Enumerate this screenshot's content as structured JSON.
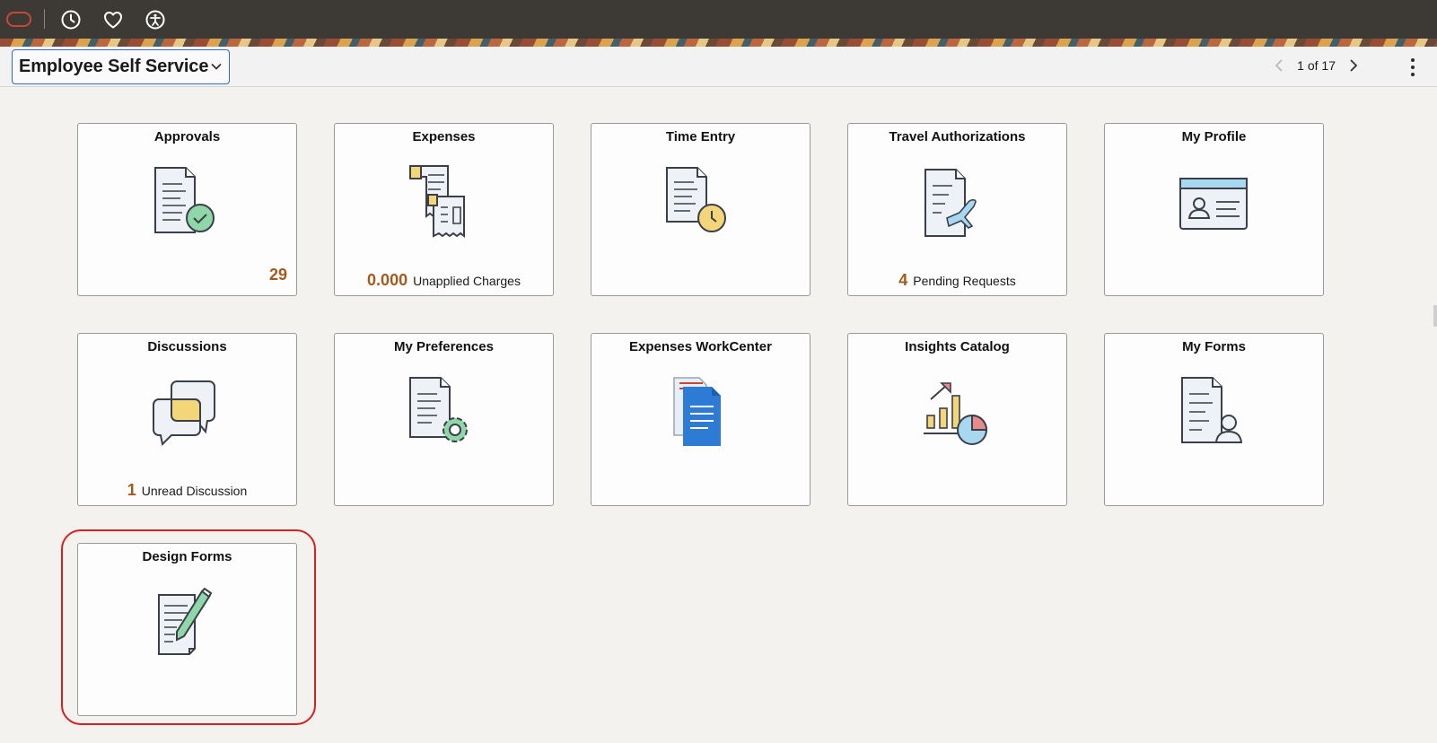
{
  "topbar": {
    "icons": [
      "oracle-logo",
      "recent-history-icon",
      "favorites-icon",
      "accessibility-icon"
    ]
  },
  "header": {
    "homepage_title": "Employee Self Service",
    "pager_text": "1 of 17"
  },
  "colors": {
    "topbar": "#3d3a36",
    "oracle_red": "#c74634",
    "count_color": "#a35a1c",
    "highlight": "#d42020",
    "select_border": "#2e6ad1"
  },
  "tiles": [
    {
      "title": "Approvals",
      "icon": "approvals-icon",
      "badge": "29"
    },
    {
      "title": "Expenses",
      "icon": "expenses-icon",
      "count": "0.000",
      "label": "Unapplied Charges"
    },
    {
      "title": "Time Entry",
      "icon": "time-entry-icon"
    },
    {
      "title": "Travel Authorizations",
      "icon": "travel-authorization-icon",
      "count": "4",
      "label": "Pending Requests"
    },
    {
      "title": "My Profile",
      "icon": "profile-card-icon"
    },
    {
      "title": "Discussions",
      "icon": "discussions-icon",
      "count": "1",
      "label": "Unread Discussion"
    },
    {
      "title": "My Preferences",
      "icon": "preferences-icon"
    },
    {
      "title": "Expenses WorkCenter",
      "icon": "workcenter-icon"
    },
    {
      "title": "Insights Catalog",
      "icon": "insights-icon"
    },
    {
      "title": "My Forms",
      "icon": "my-forms-icon"
    },
    {
      "title": "Design Forms",
      "icon": "design-forms-icon",
      "highlighted": true
    }
  ]
}
